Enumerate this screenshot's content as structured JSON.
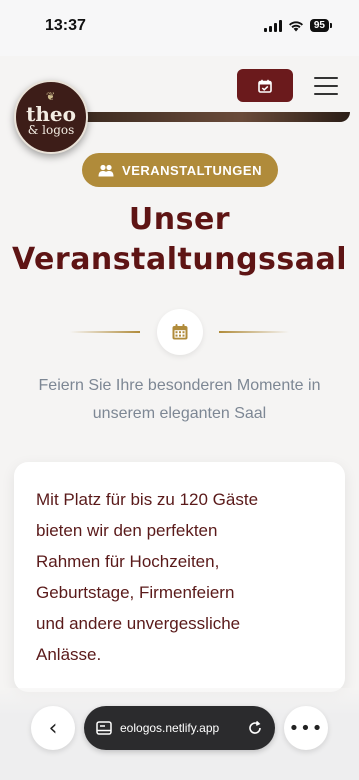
{
  "status_bar": {
    "time": "13:37",
    "battery": "95"
  },
  "header": {
    "logo": {
      "line1": "theo",
      "line2": "& logos"
    },
    "calendar_icon": "calendar-check-icon",
    "menu_icon": "hamburger-menu-icon"
  },
  "badge": {
    "icon": "people-icon",
    "label": "VERANSTALTUNGEN"
  },
  "title": {
    "line1": "Unser",
    "line2": "Veranstaltungssaal"
  },
  "divider_icon": "calendar-icon",
  "subtitle": {
    "line1": "Feiern Sie Ihre besonderen Momente in",
    "line2": "unserem eleganten Saal"
  },
  "card": {
    "lines": [
      "Mit Platz für bis zu 120 Gäste",
      "bieten wir den perfekten",
      "Rahmen für Hochzeiten,",
      "Geburtstage, Firmenfeiern",
      "und andere unvergessliche",
      "Anlässe."
    ]
  },
  "browser": {
    "url": "eologos.netlify.app"
  },
  "colors": {
    "brand_dark": "#6b1a1c",
    "gold": "#b08b3a",
    "heading": "#5e1414"
  }
}
